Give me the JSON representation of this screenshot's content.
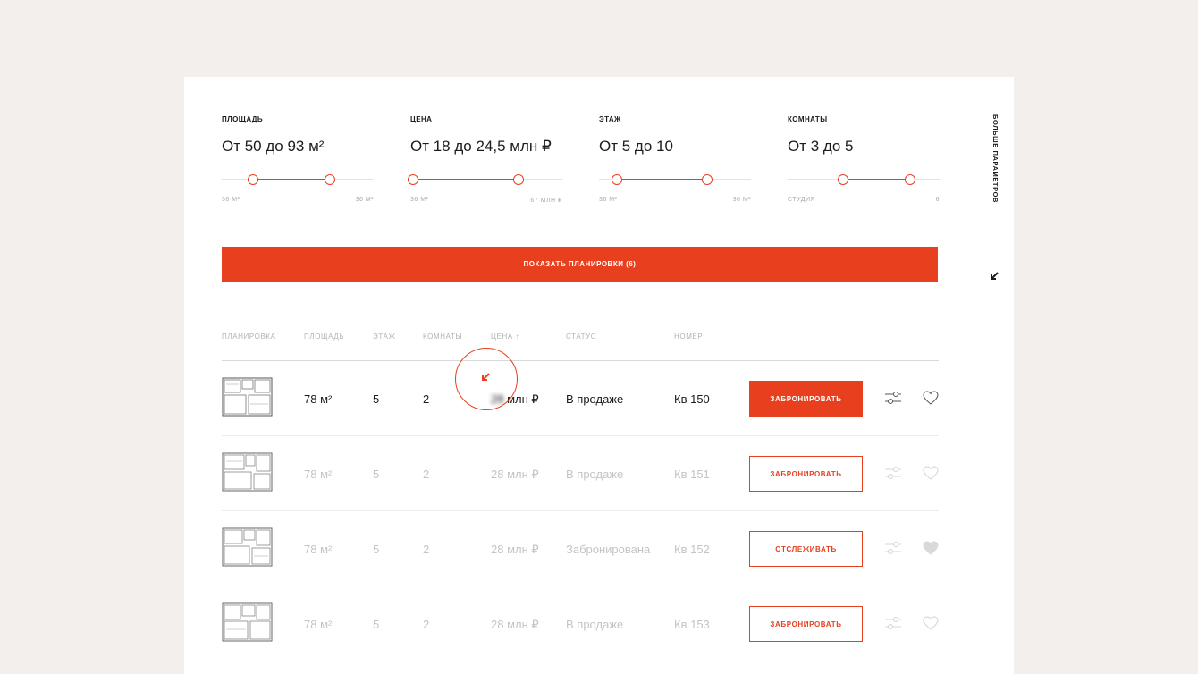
{
  "filters": [
    {
      "label": "ПЛОЩАДЬ",
      "value": "От 50 до 93 м²",
      "min_label": "36 М²",
      "max_label": "36 М²",
      "range": [
        0.2,
        0.71
      ]
    },
    {
      "label": "ЦЕНА",
      "value": "От 18 до 24,5 млн ₽",
      "min_label": "36 М²",
      "max_label": "67 МЛН ₽",
      "range": [
        0.02,
        0.71
      ]
    },
    {
      "label": "ЭТАЖ",
      "value": "От 5 до 10",
      "min_label": "36 М²",
      "max_label": "36 М²",
      "range": [
        0.12,
        0.71
      ]
    },
    {
      "label": "КОМНАТЫ",
      "value": "От 3 до 5",
      "min_label": "СТУДИЯ",
      "max_label": "6",
      "range": [
        0.36,
        0.8
      ]
    }
  ],
  "more_params_label": "БОЛЬШЕ ПАРАМЕТРОВ",
  "show_button_label": "ПОКАЗАТЬ ПЛАНИРОВКИ (6)",
  "table": {
    "columns": [
      "ПЛАНИРОВКА",
      "ПЛОЩАДЬ",
      "ЭТАЖ",
      "КОМНАТЫ",
      "ЦЕНА ↑",
      "СТАТУС",
      "НОМЕР"
    ],
    "rows": [
      {
        "area": "78 м²",
        "floor": "5",
        "rooms": "2",
        "price_hidden": "28",
        "price_unit": "млн ₽",
        "price": "28 млн ₽",
        "status": "В продаже",
        "number": "Кв 150",
        "action": "ЗАБРОНИРОВАТЬ",
        "active": true,
        "favorite": false
      },
      {
        "area": "78 м²",
        "floor": "5",
        "rooms": "2",
        "price": "28 млн ₽",
        "status": "В продаже",
        "number": "Кв 151",
        "action": "ЗАБРОНИРОВАТЬ",
        "active": false,
        "favorite": false
      },
      {
        "area": "78 м²",
        "floor": "5",
        "rooms": "2",
        "price": "28 млн ₽",
        "status": "Забронирована",
        "number": "Кв 152",
        "action": "ОТСЛЕЖИВАТЬ",
        "active": false,
        "favorite": true
      },
      {
        "area": "78 м²",
        "floor": "5",
        "rooms": "2",
        "price": "28 млн ₽",
        "status": "В продаже",
        "number": "Кв 153",
        "action": "ЗАБРОНИРОВАТЬ",
        "active": false,
        "favorite": false
      }
    ]
  },
  "icons": {
    "corner": "arrow-down-left-icon",
    "compare": "sliders-icon",
    "favorite": "heart-icon",
    "plan": "floor-plan-icon"
  },
  "colors": {
    "accent": "#e8401f",
    "background": "#f3efed",
    "card": "#ffffff",
    "muted_text": "#c4c4c4"
  }
}
